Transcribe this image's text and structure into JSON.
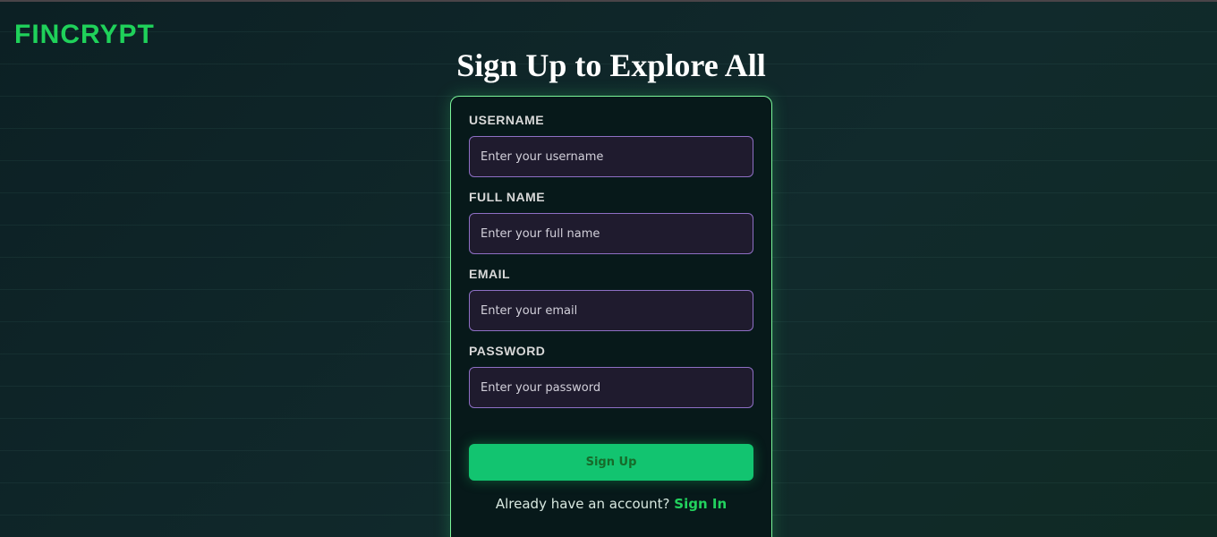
{
  "brand": {
    "name": "FINCRYPT"
  },
  "page": {
    "title": "Sign Up to Explore All"
  },
  "form": {
    "fields": [
      {
        "label": "USERNAME",
        "placeholder": "Enter your username",
        "value": ""
      },
      {
        "label": "FULL NAME",
        "placeholder": "Enter your full name",
        "value": ""
      },
      {
        "label": "EMAIL",
        "placeholder": "Enter your email",
        "value": ""
      },
      {
        "label": "PASSWORD",
        "placeholder": "Enter your password",
        "value": ""
      }
    ],
    "submit_label": "Sign Up",
    "signin_prompt": "Already have an account?",
    "signin_link": "Sign In"
  },
  "colors": {
    "brand": "#1fd15a",
    "accent": "#12c470",
    "card_border": "#7bf59a",
    "input_border": "#8e6fc4",
    "input_bg": "#1f1b2e"
  }
}
